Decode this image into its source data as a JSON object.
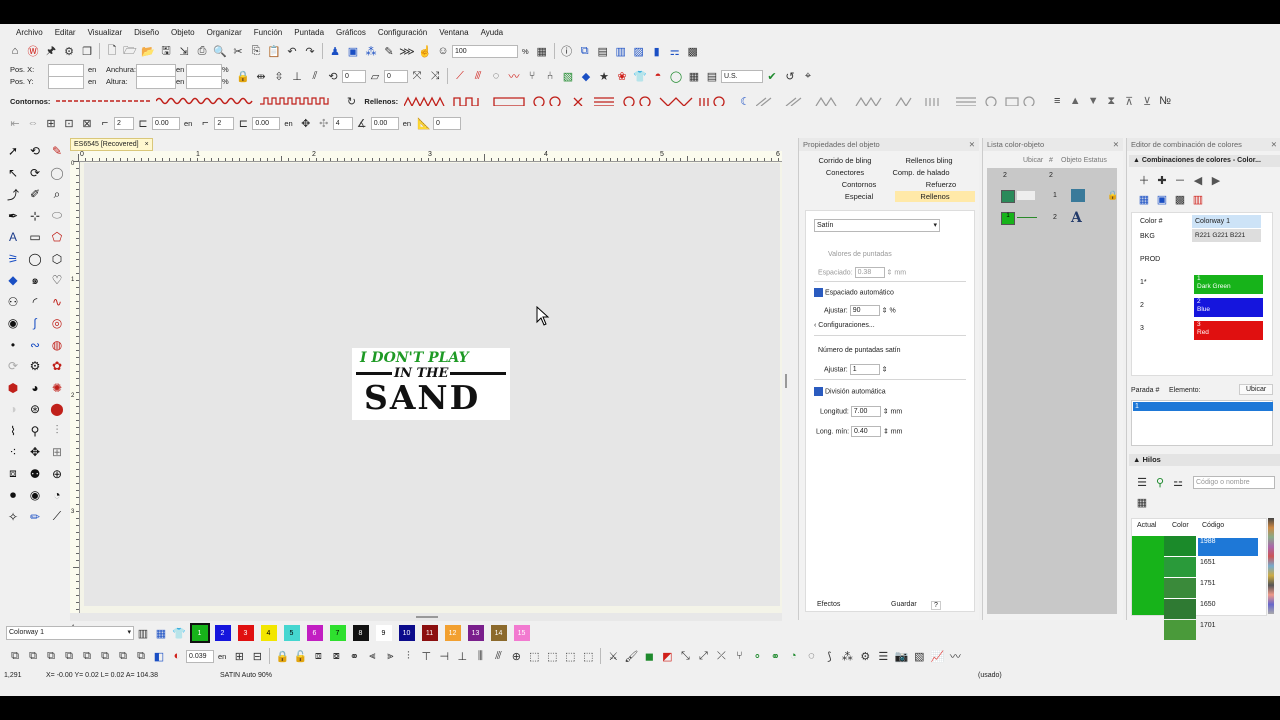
{
  "menu": [
    "Archivo",
    "Editar",
    "Visualizar",
    "Diseño",
    "Objeto",
    "Organizar",
    "Función",
    "Puntada",
    "Gráficos",
    "Configuración",
    "Ventana",
    "Ayuda"
  ],
  "toolbar": {
    "zoom_value": "100",
    "zoom_unit": "%",
    "pos_x_label": "Pos. X:",
    "pos_y_label": "Pos. Y:",
    "width_label": "Anchura:",
    "height_label": "Altura:",
    "unit_en": "en",
    "unit_pct": "%",
    "rotate_value": "0",
    "slant_value": "0",
    "us_select": "U.S.",
    "contornos_label": "Contornos:",
    "rellenos_label": "Rellenos:",
    "spin_2": "2",
    "spin_000": "0.00",
    "spin_4": "4",
    "spin_0": "0"
  },
  "document": {
    "tab_title": "ES6545 [Recovered]",
    "tab_close": "×",
    "ruler_marks": [
      "0",
      "1",
      "2",
      "3",
      "4",
      "5",
      "6"
    ],
    "vruler_marks": [
      "0",
      "1",
      "2",
      "3",
      "4"
    ],
    "art_line1": "I DON'T PLAY",
    "art_line2": "IN THE",
    "art_line3": "SAND"
  },
  "props_panel": {
    "title": "Propiedades del objeto",
    "tabs": [
      "Corrido de bling",
      "Rellenos bling",
      "Conectores",
      "Comp. de halado",
      "Contornos",
      "Refuerzo",
      "Especial",
      "Rellenos"
    ],
    "fill_type": "Satín",
    "stitch_values_label": "Valores de puntadas",
    "spacing_label": "Espaciado:",
    "spacing_value": "0.38",
    "spacing_unit": "mm",
    "auto_spacing": "Espaciado automático",
    "adjust_label": "Ajustar:",
    "adjust_value": "90",
    "adjust_unit": "%",
    "configs": "Configuraciones...",
    "satin_count_label": "Número de puntadas satín",
    "adjust2_value": "1",
    "auto_split": "División automática",
    "length_label": "Longitud:",
    "length_value": "7.00",
    "length_unit": "mm",
    "min_length_label": "Long. mín:",
    "min_length_value": "0.40",
    "min_length_unit": "mm",
    "effects_btn": "Efectos",
    "save_btn": "Guardar",
    "help_btn": "?"
  },
  "colorlist_panel": {
    "title": "Lista color-objeto",
    "col_ubicar": "Ubicar",
    "col_num": "#",
    "col_obj": "Objeto Estatus",
    "header_left": "2",
    "header_right": "2",
    "rows": [
      {
        "num": "1"
      },
      {
        "num": "2"
      }
    ]
  },
  "colorway_panel": {
    "title": "Editor de combinación de colores",
    "section": "Combinaciones de colores - Color...",
    "col_color": "Color #",
    "col_colorway": "Colorway 1",
    "bkg_label": "BKG",
    "bkg_value": "R221 G221 B221",
    "prod_label": "PROD",
    "entries": [
      {
        "num": "1*",
        "code": "1",
        "name": "Dark Green",
        "color": "#17b31a"
      },
      {
        "num": "2",
        "code": "2",
        "name": "Blue",
        "color": "#1515dd"
      },
      {
        "num": "3",
        "code": "3",
        "name": "Red",
        "color": "#e01010"
      }
    ],
    "stop_label": "Parada #",
    "element_label": "Elemento:",
    "locate_btn": "Ubicar",
    "stop_item": "1",
    "threads_title": "Hilos",
    "thread_search_placeholder": "Código o nombre",
    "thread_cols": [
      "Actual",
      "Color",
      "Código"
    ],
    "threads": [
      "1988",
      "1651",
      "1751",
      "1650",
      "1701"
    ]
  },
  "colorbar": {
    "colorway_select": "Colorway 1",
    "swatches": [
      {
        "n": "1",
        "c": "#17b31a"
      },
      {
        "n": "2",
        "c": "#1515dd"
      },
      {
        "n": "3",
        "c": "#e01010"
      },
      {
        "n": "4",
        "c": "#f2e600"
      },
      {
        "n": "5",
        "c": "#45d6d0"
      },
      {
        "n": "6",
        "c": "#c21ec2"
      },
      {
        "n": "7",
        "c": "#2ee02e"
      },
      {
        "n": "8",
        "c": "#111111"
      },
      {
        "n": "9",
        "c": "#ffffff"
      },
      {
        "n": "10",
        "c": "#0c0c8c"
      },
      {
        "n": "11",
        "c": "#8c1010"
      },
      {
        "n": "12",
        "c": "#f2a030"
      },
      {
        "n": "13",
        "c": "#7a1f8c"
      },
      {
        "n": "14",
        "c": "#8c6a2c"
      },
      {
        "n": "15",
        "c": "#f27ad0"
      }
    ]
  },
  "bottom_toolbar": {
    "value": "0.039",
    "unit": "en"
  },
  "status": {
    "coords": "1,291",
    "xy": "X= -0.00 Y= 0.02 L= 0.02 A= 104.38",
    "mode": "SATIN Auto 90%",
    "right": "(usado)"
  }
}
